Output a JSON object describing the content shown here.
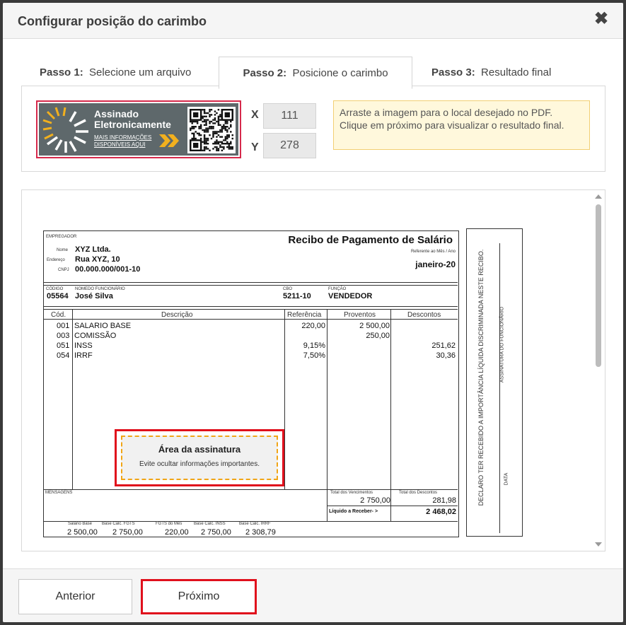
{
  "modal": {
    "title": "Configurar posição do carimbo",
    "close_icon": "✖"
  },
  "tabs": [
    {
      "step": "Passo 1:",
      "label": "Selecione um arquivo",
      "active": false
    },
    {
      "step": "Passo 2:",
      "label": "Posicione o carimbo",
      "active": true
    },
    {
      "step": "Passo 3:",
      "label": "Resultado final",
      "active": false
    }
  ],
  "stamp": {
    "title_line1": "Assinado",
    "title_line2": "Eletronicamente",
    "link_line1": "MAIS INFORMAÇÕES",
    "link_line2": "DISPONÍVEIS AQUI",
    "background": "#5e686b",
    "accent": "#f2b01e"
  },
  "position": {
    "x_label": "X",
    "x_value": "111",
    "y_label": "Y",
    "y_value": "278"
  },
  "hint": {
    "line1": "Arraste a imagem para o local desejado no PDF.",
    "line2": "Clique em próximo para visualizar o resultado final."
  },
  "receipt": {
    "employer_label": "EMPREGADOR",
    "name_label": "Nome",
    "name": "XYZ Ltda.",
    "address_label": "Endereço",
    "address": "Rua XYZ, 10",
    "cnpj_label": "CNPJ",
    "cnpj": "00.000.000/001-10",
    "title": "Recibo de Pagamento de Salário",
    "ref_label": "Referente ao Mês / Ano",
    "ref_value": "janeiro-20",
    "code_label": "CÓDIGO",
    "employee_label": "NOMEDO FUNCIONÁRIO",
    "code": "05564",
    "employee": "José Silva",
    "cbo_label": "CBO",
    "cbo": "5211-10",
    "func_label": "FUNÇÃO",
    "func": "VENDEDOR",
    "columns": [
      "Cód.",
      "Descrição",
      "Referência",
      "Proventos",
      "Descontos"
    ],
    "rows": [
      {
        "code": "001",
        "desc": "SALARIO BASE",
        "ref": "220,00",
        "prov": "2 500,00",
        "disc": ""
      },
      {
        "code": "003",
        "desc": "COMISSÃO",
        "ref": "",
        "prov": "250,00",
        "disc": ""
      },
      {
        "code": "051",
        "desc": "INSS",
        "ref": "9,15%",
        "prov": "",
        "disc": "251,62"
      },
      {
        "code": "054",
        "desc": "IRRF",
        "ref": "7,50%",
        "prov": "",
        "disc": "30,36"
      }
    ],
    "messages_label": "MENSAGENS",
    "total_venc_label": "Total dos Vencimentos",
    "total_venc": "2 750,00",
    "total_desc_label": "Total dos Descontos",
    "total_desc": "281,98",
    "liquido_label": "Líquido a Receber- >",
    "liquido": "2 468,02",
    "bottom_labels": [
      "Salário Base",
      "Base Cálc. FGTS",
      "FGTS do Mês",
      "Base Cálc. INSS",
      "Base Cálc. IRRF"
    ],
    "bottom_values": [
      "2 500,00",
      "2 750,00",
      "220,00",
      "2 750,00",
      "2 308,79"
    ],
    "side_declaration": "DECLARO TER RECEBIDO A IMPORTÂNCIA LÍQUIDA DISCRIMINADA NESTE RECIBO.",
    "side_signature": "ASSINATURA DO FUNCIONÁRIO",
    "side_date": "DATA"
  },
  "signature_area": {
    "title": "Área da assinatura",
    "subtitle": "Evite ocultar informações importantes."
  },
  "footer": {
    "prev_label": "Anterior",
    "next_label": "Próximo"
  },
  "colors": {
    "highlight_red": "#e0101c",
    "dashed_orange": "#f1a516",
    "hint_bg": "#fff8dc"
  }
}
